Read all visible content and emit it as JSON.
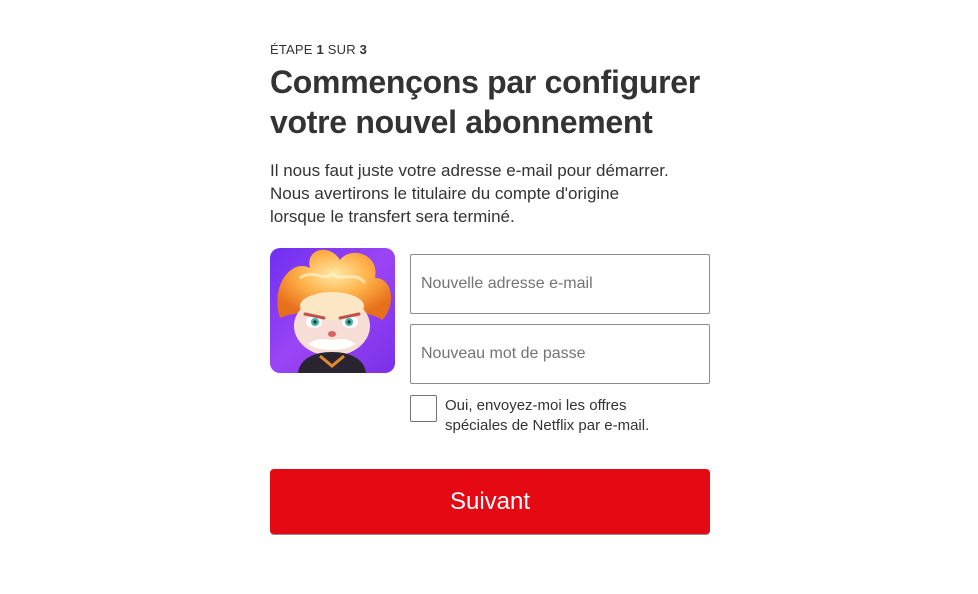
{
  "step": {
    "prefix": "ÉTAPE",
    "current": "1",
    "middle": "SUR",
    "total": "3"
  },
  "heading": {
    "line1": "Commençons par configurer",
    "line2": "votre nouvel abonnement"
  },
  "description": {
    "line1": "Il nous faut juste votre adresse e-mail pour démarrer.",
    "line2": "Nous avertirons le titulaire du compte d'origine",
    "line3": "lorsque le transfert sera terminé."
  },
  "form": {
    "email_placeholder": "Nouvelle adresse e-mail",
    "email_value": "",
    "password_placeholder": "Nouveau mot de passe",
    "password_value": "",
    "offers_checked": false,
    "offers_label_line1": "Oui, envoyez-moi les offres",
    "offers_label_line2": "spéciales de Netflix par e-mail."
  },
  "profile_avatar": {
    "icon": "profile-avatar-character",
    "background_color": "#8a3ff0"
  },
  "next_button": {
    "label": "Suivant",
    "color": "#e50914"
  }
}
